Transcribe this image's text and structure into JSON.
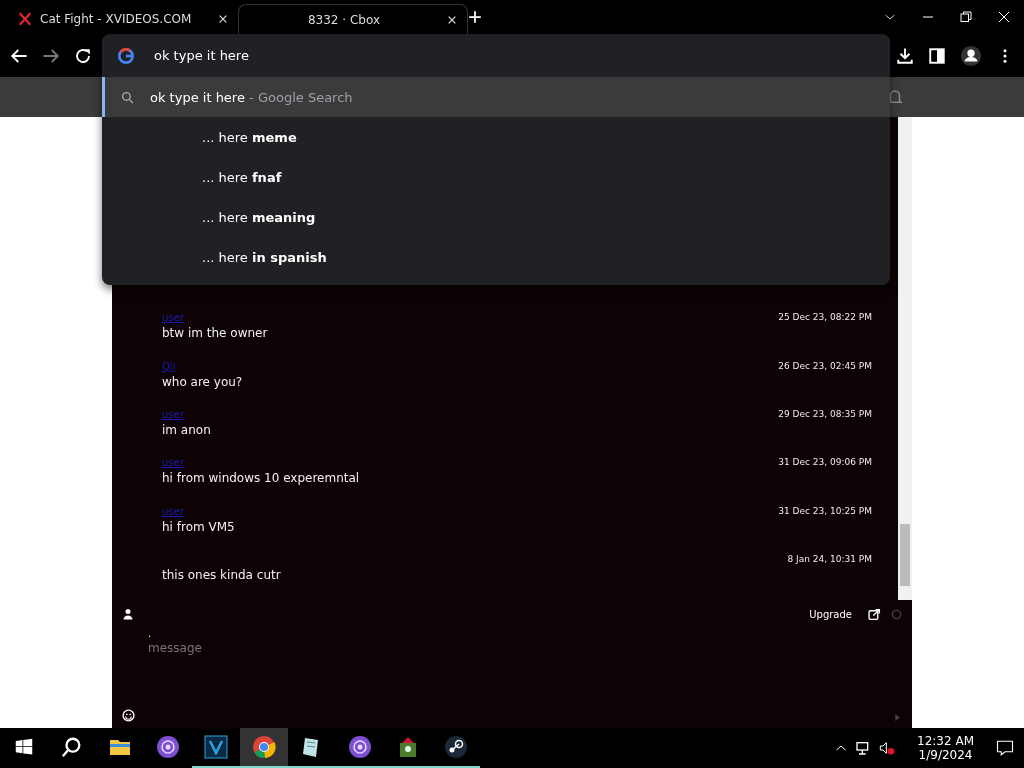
{
  "tabs": [
    {
      "title": "Cat Fight - XVIDEOS.COM",
      "kind": "x",
      "selected": false
    },
    {
      "title": "8332 · Cbox",
      "kind": "none",
      "selected": true
    }
  ],
  "omnibox": {
    "value": "ok type it here",
    "suggestions": [
      {
        "kind": "search",
        "text": "ok type it here",
        "hint": "- Google Search",
        "selected": true
      },
      {
        "kind": "completion",
        "prefix": "... here",
        "bold": "meme",
        "selected": false
      },
      {
        "kind": "completion",
        "prefix": "... here",
        "bold": "fnaf",
        "selected": false
      },
      {
        "kind": "completion",
        "prefix": "... here",
        "bold": "meaning",
        "selected": false
      },
      {
        "kind": "completion",
        "prefix": "... here",
        "bold": "in spanish",
        "selected": false
      }
    ]
  },
  "chat": {
    "messages": [
      {
        "user": "user",
        "time": "25 Dec 23, 08:22 PM",
        "text": "btw im the owner"
      },
      {
        "user": "Qij",
        "time": "26 Dec 23, 02:45 PM",
        "text": "who are you?"
      },
      {
        "user": "user",
        "time": "29 Dec 23, 08:35 PM",
        "text": "im anon"
      },
      {
        "user": "user",
        "time": "31 Dec 23, 09:06 PM",
        "text": "hi from windows 10 experemntal"
      },
      {
        "user": "user",
        "time": "31 Dec 23, 10:25 PM",
        "text": "hi from VM5"
      },
      {
        "time": "8 Jan 24, 10:31 PM",
        "text": "this ones kinda cutr"
      }
    ],
    "upgrade": "Upgrade",
    "name_value": ".",
    "placeholder": "message"
  },
  "taskbar": {
    "apps": [
      {
        "kind": "folder",
        "running": false,
        "selected": false
      },
      {
        "kind": "tor",
        "running": false,
        "selected": false
      },
      {
        "kind": "v",
        "running": true,
        "selected": false
      },
      {
        "kind": "chrome",
        "running": true,
        "selected": true
      },
      {
        "kind": "notepad",
        "running": true,
        "selected": false
      },
      {
        "kind": "tor",
        "running": true,
        "selected": false
      },
      {
        "kind": "game",
        "running": true,
        "selected": false
      },
      {
        "kind": "steam",
        "running": true,
        "selected": false
      }
    ],
    "time": "12:32 AM",
    "date": "1/9/2024"
  }
}
